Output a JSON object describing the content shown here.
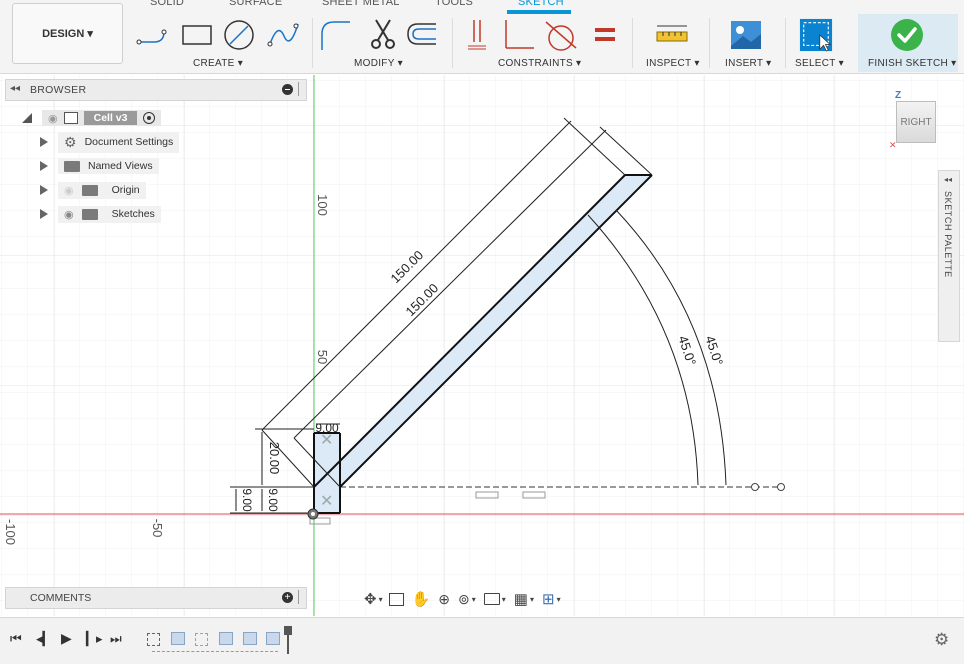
{
  "workspace": {
    "design_label": "DESIGN ▾"
  },
  "tabs": [
    {
      "label": "SOLID",
      "active": false
    },
    {
      "label": "SURFACE",
      "active": false
    },
    {
      "label": "SHEET METAL",
      "active": false
    },
    {
      "label": "TOOLS",
      "active": false
    },
    {
      "label": "SKETCH",
      "active": true
    }
  ],
  "groups": {
    "create": "CREATE ▾",
    "modify": "MODIFY ▾",
    "constraints": "CONSTRAINTS ▾",
    "inspect": "INSPECT ▾",
    "insert": "INSERT ▾",
    "select": "SELECT ▾",
    "finish": "FINISH SKETCH ▾"
  },
  "browser": {
    "title": "BROWSER",
    "root": "Cell v3",
    "items": [
      {
        "label": "Document Settings",
        "icon": "gear-icon"
      },
      {
        "label": "Named Views",
        "icon": "folder-icon"
      },
      {
        "label": "Origin",
        "icon": "folder-icon"
      },
      {
        "label": "Sketches",
        "icon": "folder-icon"
      }
    ]
  },
  "comments": {
    "title": "COMMENTS"
  },
  "palette": {
    "label": "SKETCH PALETTE"
  },
  "viewcube": {
    "face": "RIGHT",
    "axis": "Z"
  },
  "dimensions": {
    "len_outer": "150.00",
    "len_inner": "150.00",
    "angle_outer": "45.0°",
    "angle_inner": "45.0°",
    "height_20": "20.00",
    "height_9a": "9.00",
    "height_9b": "9.00",
    "width_top": "9.00"
  },
  "axis_labels": {
    "v100": "100",
    "v50": "50",
    "h_neg100": "-100",
    "h_neg50": "-50"
  },
  "colors": {
    "accent": "#0696d7",
    "finish_green": "#3cb34a",
    "axis_red": "#e05050",
    "axis_green": "#5cc85c"
  }
}
